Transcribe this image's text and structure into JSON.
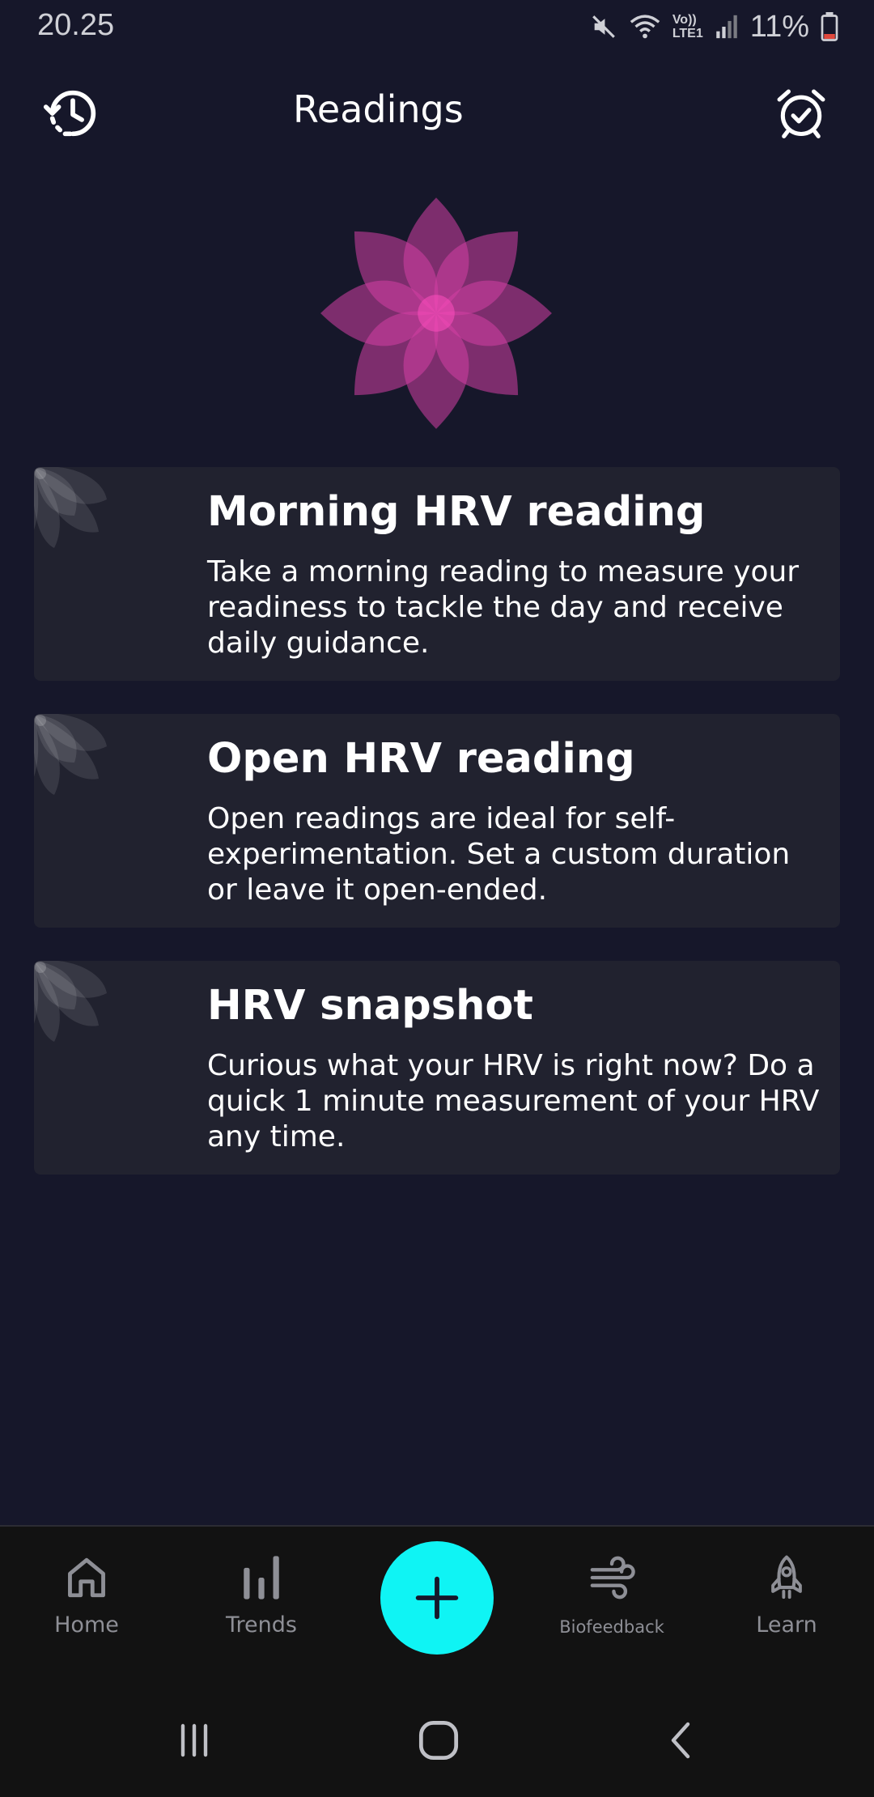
{
  "status_bar": {
    "time": "20.25",
    "battery_text": "11%",
    "icons": [
      "mute-icon",
      "wifi-icon",
      "volte-icon",
      "signal-icon",
      "battery-icon"
    ],
    "volte_line1": "Vo))",
    "volte_line2": "LTE1"
  },
  "header": {
    "title": "Readings",
    "left_icon": "history-icon",
    "right_icon": "alarm-icon"
  },
  "colors": {
    "background": "#16172a",
    "card": "#21222f",
    "accent": "#0ff4f4",
    "logo": "#e040a8"
  },
  "cards": [
    {
      "title": "Morning HRV reading",
      "description": "Take a morning reading to measure your readiness to tackle the day and receive daily guidance."
    },
    {
      "title": "Open HRV reading",
      "description": "Open readings are ideal for self-experimentation. Set a custom duration or leave it open-ended."
    },
    {
      "title": "HRV snapshot",
      "description": "Curious what your HRV is right now? Do a quick 1 minute measurement of your HRV any time."
    }
  ],
  "bottom_nav": {
    "items": [
      {
        "label": "Home",
        "icon": "home-icon"
      },
      {
        "label": "Trends",
        "icon": "bar-chart-icon"
      },
      {
        "label": "",
        "icon": "plus-icon"
      },
      {
        "label": "Biofeedback",
        "icon": "wind-icon"
      },
      {
        "label": "Learn",
        "icon": "rocket-icon"
      }
    ]
  },
  "system_nav": [
    "recents-icon",
    "home-circle-icon",
    "back-icon"
  ]
}
